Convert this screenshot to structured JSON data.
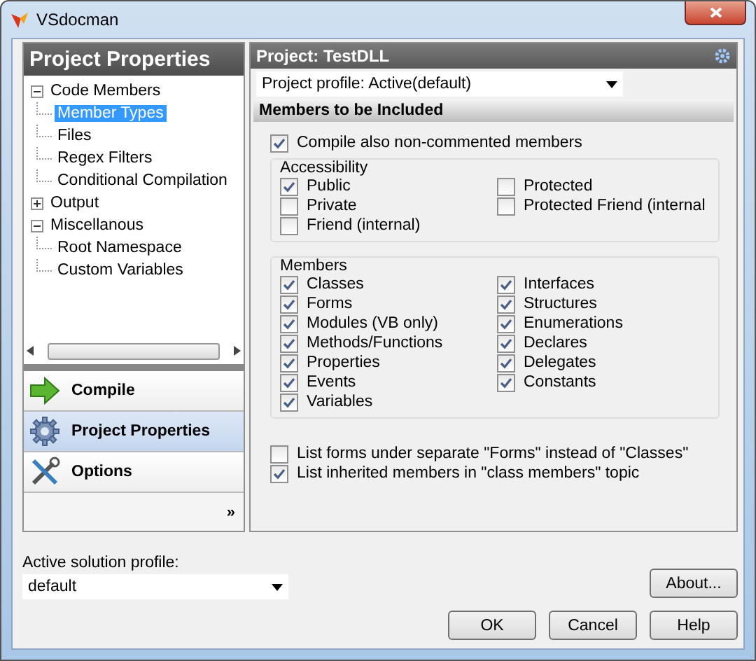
{
  "window": {
    "title": "VSdocman"
  },
  "sidebar": {
    "title": "Project Properties",
    "tree": [
      {
        "label": "Code Members",
        "expanded": true,
        "children": [
          {
            "label": "Member Types",
            "selected": true
          },
          {
            "label": "Files",
            "selected": false
          },
          {
            "label": "Regex Filters",
            "selected": false
          },
          {
            "label": "Conditional Compilation",
            "selected": false
          }
        ]
      },
      {
        "label": "Output",
        "expanded": false
      },
      {
        "label": "Miscellanous",
        "expanded": true,
        "children": [
          {
            "label": "Root Namespace",
            "selected": false
          },
          {
            "label": "Custom Variables",
            "selected": false
          }
        ]
      }
    ],
    "nav": [
      {
        "label": "Compile",
        "kind": "compile",
        "selected": false
      },
      {
        "label": "Project Properties",
        "kind": "properties",
        "selected": true
      },
      {
        "label": "Options",
        "kind": "options",
        "selected": false
      }
    ],
    "more": "»"
  },
  "main": {
    "title": "Project: TestDLL",
    "profile": {
      "label": "Project profile:",
      "value": "Active(default)"
    },
    "section": "Members to be Included",
    "compile_option": {
      "label": "Compile also non-commented members",
      "checked": true
    },
    "accessibility": {
      "title": "Accessibility",
      "options": [
        {
          "label": "Public",
          "checked": true
        },
        {
          "label": "Private",
          "checked": false
        },
        {
          "label": "Friend (internal)",
          "checked": false
        },
        {
          "label": "Protected",
          "checked": false
        },
        {
          "label": "Protected Friend (internal",
          "checked": false
        }
      ]
    },
    "members": {
      "title": "Members",
      "options": [
        {
          "label": "Classes",
          "checked": true
        },
        {
          "label": "Forms",
          "checked": true
        },
        {
          "label": "Modules (VB only)",
          "checked": true
        },
        {
          "label": "Methods/Functions",
          "checked": true
        },
        {
          "label": "Properties",
          "checked": true
        },
        {
          "label": "Events",
          "checked": true
        },
        {
          "label": "Variables",
          "checked": true
        },
        {
          "label": "Interfaces",
          "checked": true
        },
        {
          "label": "Structures",
          "checked": true
        },
        {
          "label": "Enumerations",
          "checked": true
        },
        {
          "label": "Declares",
          "checked": true
        },
        {
          "label": "Delegates",
          "checked": true
        },
        {
          "label": "Constants",
          "checked": true
        }
      ]
    },
    "list_options": [
      {
        "label": "List forms under separate \"Forms\" instead of \"Classes\"",
        "checked": false
      },
      {
        "label": "List inherited members in \"class members\" topic",
        "checked": true
      }
    ]
  },
  "solution_profile": {
    "label": "Active solution profile:",
    "value": "default"
  },
  "about_button": "About...",
  "buttons": [
    "OK",
    "Cancel",
    "Help"
  ]
}
